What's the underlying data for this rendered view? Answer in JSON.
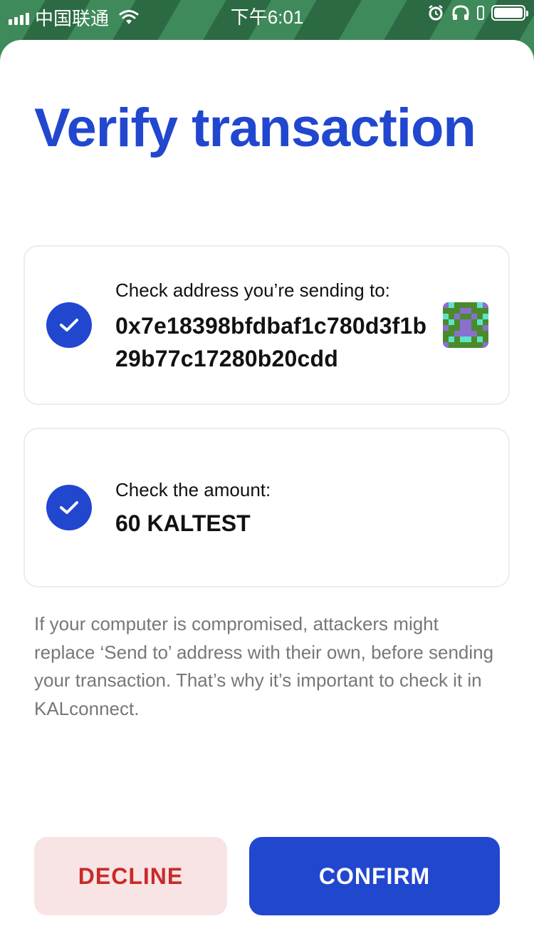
{
  "status_bar": {
    "carrier": "中国联通",
    "time": "下午6:01"
  },
  "title": "Verify transaction",
  "address_card": {
    "label": "Check address you’re sending to:",
    "address": "0x7e18398bfdbaf1c780d3f1b29b77c17280b20cdd"
  },
  "amount_card": {
    "label": "Check the amount:",
    "amount": "60 KALTEST"
  },
  "warning": "If your computer is compromised, attackers might replace ‘Send to’ address with their own, before sending your transaction. That’s why it’s important to check it in KALconnect.",
  "buttons": {
    "decline": "DECLINE",
    "confirm": "CONFIRM"
  },
  "colors": {
    "accent": "#2147cf",
    "decline_text": "#c92a2a",
    "decline_bg": "#f8e4e4",
    "identicon_green": "#4a8a2a",
    "identicon_purple": "#8a6fd1",
    "identicon_cyan": "#5fe3c8"
  },
  "icons": {
    "check": "checkmark-icon",
    "identicon": "address-identicon"
  }
}
